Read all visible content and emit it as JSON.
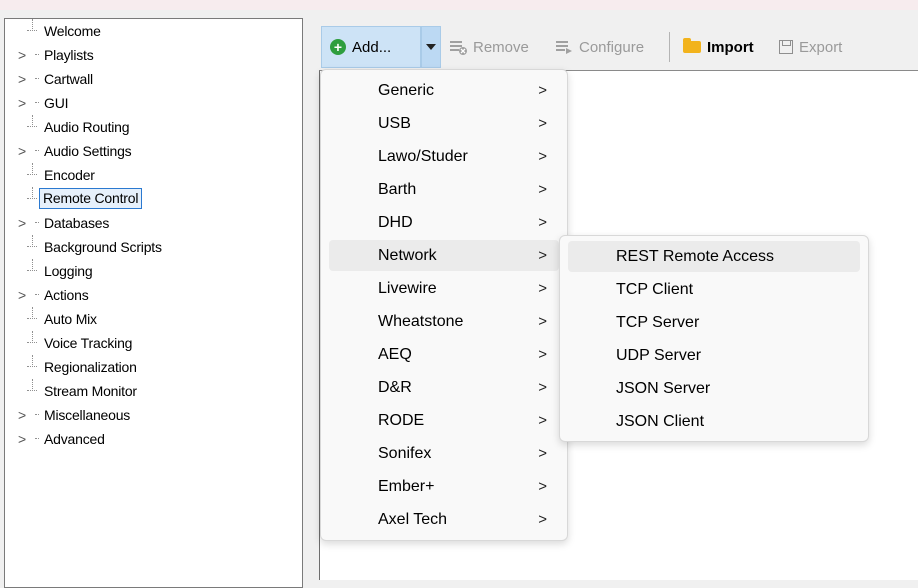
{
  "tree": {
    "items": [
      {
        "label": "Welcome",
        "expandable": false
      },
      {
        "label": "Playlists",
        "expandable": true
      },
      {
        "label": "Cartwall",
        "expandable": true
      },
      {
        "label": "GUI",
        "expandable": true
      },
      {
        "label": "Audio Routing",
        "expandable": false
      },
      {
        "label": "Audio Settings",
        "expandable": true
      },
      {
        "label": "Encoder",
        "expandable": false
      },
      {
        "label": "Remote Control",
        "expandable": false,
        "selected": true
      },
      {
        "label": "Databases",
        "expandable": true
      },
      {
        "label": "Background Scripts",
        "expandable": false
      },
      {
        "label": "Logging",
        "expandable": false
      },
      {
        "label": "Actions",
        "expandable": true
      },
      {
        "label": "Auto Mix",
        "expandable": false
      },
      {
        "label": "Voice Tracking",
        "expandable": false
      },
      {
        "label": "Regionalization",
        "expandable": false
      },
      {
        "label": "Stream Monitor",
        "expandable": false
      },
      {
        "label": "Miscellaneous",
        "expandable": true
      },
      {
        "label": "Advanced",
        "expandable": true
      }
    ],
    "expander_glyph": ">"
  },
  "toolbar": {
    "add_label": "Add...",
    "remove_label": "Remove",
    "configure_label": "Configure",
    "import_label": "Import",
    "export_label": "Export"
  },
  "add_menu": {
    "items": [
      {
        "label": "Generic"
      },
      {
        "label": "USB"
      },
      {
        "label": "Lawo/Studer"
      },
      {
        "label": "Barth"
      },
      {
        "label": "DHD"
      },
      {
        "label": "Network",
        "highlighted": true
      },
      {
        "label": "Livewire"
      },
      {
        "label": "Wheatstone"
      },
      {
        "label": "AEQ"
      },
      {
        "label": "D&R"
      },
      {
        "label": "RODE"
      },
      {
        "label": "Sonifex"
      },
      {
        "label": "Ember+"
      },
      {
        "label": "Axel Tech"
      }
    ],
    "arrow_glyph": ">"
  },
  "network_submenu": {
    "items": [
      {
        "label": "REST Remote Access",
        "highlighted": true
      },
      {
        "label": "TCP Client"
      },
      {
        "label": "TCP Server"
      },
      {
        "label": "UDP Server"
      },
      {
        "label": "JSON Server"
      },
      {
        "label": "JSON Client"
      }
    ]
  },
  "colors": {
    "selection_border": "#2b79d0",
    "add_button_bg": "#cde3f6",
    "add_icon": "#2e9e3e",
    "folder_icon": "#f2b31c",
    "menu_highlight": "#ebebeb"
  }
}
